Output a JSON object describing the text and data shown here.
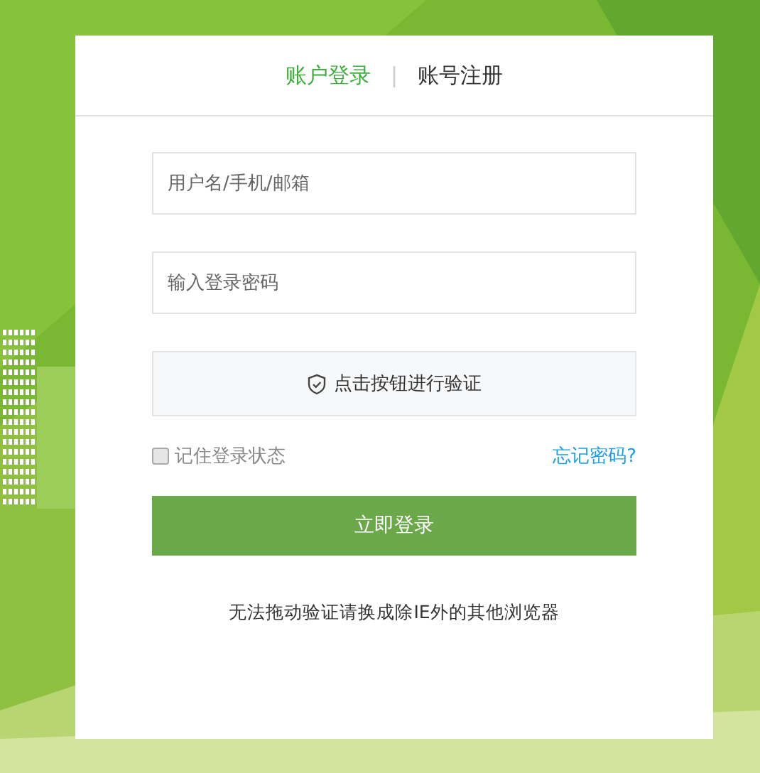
{
  "tabs": [
    {
      "label": "账户登录",
      "selected": true
    },
    {
      "label": "账号注册",
      "selected": false
    }
  ],
  "tab_separator": "|",
  "username": {
    "placeholder": "用户名/手机/邮箱"
  },
  "password": {
    "placeholder": "输入登录密码"
  },
  "verify_button": {
    "label": "点击按钮进行验证"
  },
  "remember": {
    "label": "记住登录状态",
    "checked": false
  },
  "forgot_link": "忘记密码?",
  "login_button": "立即登录",
  "note": "无法拖动验证请换成除IE外的其他浏览器"
}
